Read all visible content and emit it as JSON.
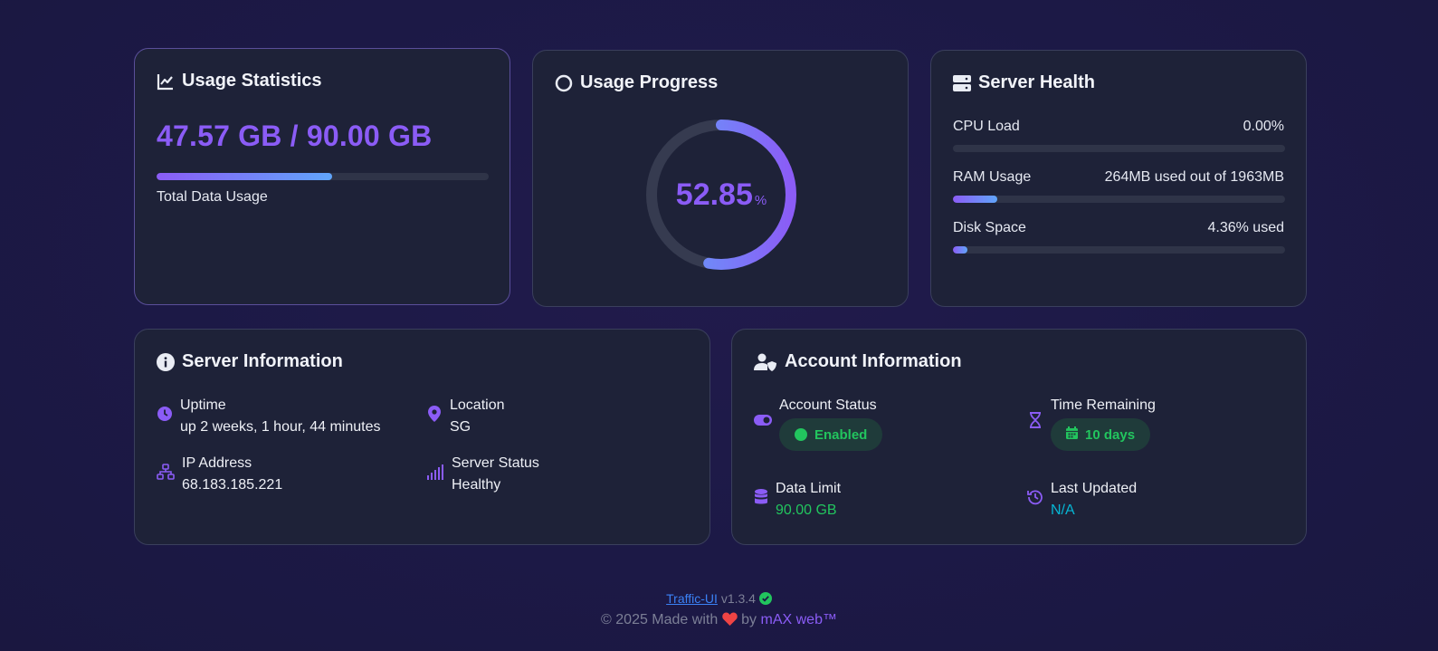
{
  "usage_stats": {
    "title": "Usage Statistics",
    "amount": "47.57 GB / 90.00 GB",
    "fraction": 0.5285,
    "caption": "Total Data Usage"
  },
  "usage_progress": {
    "title": "Usage Progress",
    "percent_value": "52.85",
    "percent_unit": "%",
    "fraction": 0.5285
  },
  "server_health": {
    "title": "Server Health",
    "rows": [
      {
        "label": "CPU Load",
        "value": "0.00%",
        "fraction": 0.0
      },
      {
        "label": "RAM Usage",
        "value": "264MB used out of 1963MB",
        "fraction": 0.1345
      },
      {
        "label": "Disk Space",
        "value": "4.36% used",
        "fraction": 0.0436
      }
    ]
  },
  "server_info": {
    "title": "Server Information",
    "uptime_label": "Uptime",
    "uptime_value": "up 2 weeks, 1 hour, 44 minutes",
    "location_label": "Location",
    "location_value": "SG",
    "ip_label": "IP Address",
    "ip_value": "68.183.185.221",
    "status_label": "Server Status",
    "status_value": "Healthy"
  },
  "account_info": {
    "title": "Account Information",
    "status_label": "Account Status",
    "status_value": "Enabled",
    "time_label": "Time Remaining",
    "time_value": "10 days",
    "limit_label": "Data Limit",
    "limit_value": "90.00 GB",
    "updated_label": "Last Updated",
    "updated_value": "N/A"
  },
  "footer": {
    "app_link": "Traffic-UI",
    "version": "v1.3.4",
    "made_prefix": "© 2025 Made with",
    "made_by": "by",
    "brand": "mAX web™"
  },
  "colors": {
    "accent": "#8b5cf6",
    "accent2": "#60a5fa",
    "success": "#22c55e",
    "info": "#06b6d4",
    "heart": "#ef4444"
  }
}
